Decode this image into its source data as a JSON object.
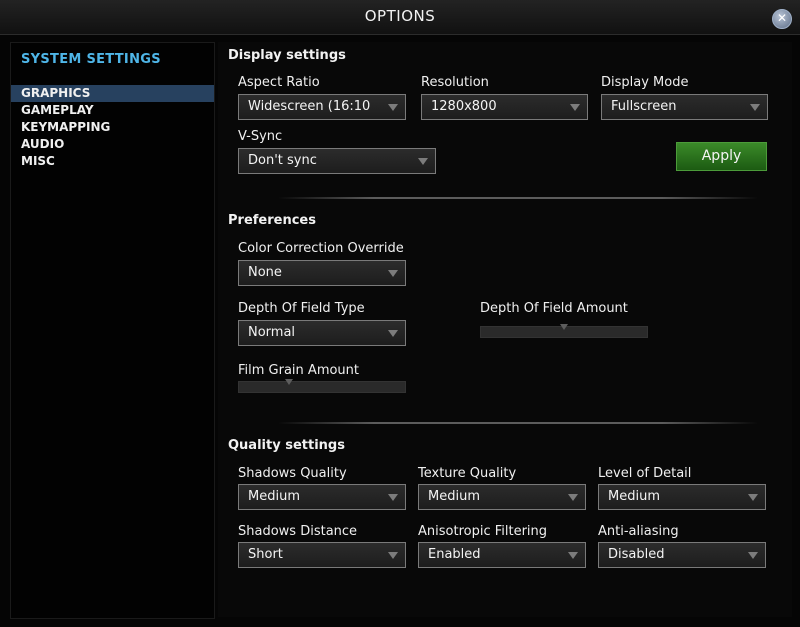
{
  "window": {
    "title": "OPTIONS"
  },
  "sidebar": {
    "heading": "SYSTEM SETTINGS",
    "items": [
      {
        "label": "GRAPHICS",
        "active": true
      },
      {
        "label": "GAMEPLAY",
        "active": false
      },
      {
        "label": "KEYMAPPING",
        "active": false
      },
      {
        "label": "AUDIO",
        "active": false
      },
      {
        "label": "MISC",
        "active": false
      }
    ]
  },
  "display": {
    "title": "Display settings",
    "aspect_ratio": {
      "label": "Aspect Ratio",
      "value": "Widescreen (16:10"
    },
    "resolution": {
      "label": "Resolution",
      "value": "1280x800"
    },
    "display_mode": {
      "label": "Display Mode",
      "value": "Fullscreen"
    },
    "vsync": {
      "label": "V-Sync",
      "value": "Don't sync"
    },
    "apply_label": "Apply"
  },
  "preferences": {
    "title": "Preferences",
    "color_correction": {
      "label": "Color Correction Override",
      "value": "None"
    },
    "dof_type": {
      "label": "Depth Of Field Type",
      "value": "Normal"
    },
    "dof_amount": {
      "label": "Depth Of Field Amount",
      "level": 0.5
    },
    "film_grain": {
      "label": "Film Grain Amount",
      "level": 0.3
    }
  },
  "quality": {
    "title": "Quality settings",
    "shadows_quality": {
      "label": "Shadows Quality",
      "value": "Medium"
    },
    "texture_quality": {
      "label": "Texture Quality",
      "value": "Medium"
    },
    "level_of_detail": {
      "label": "Level of Detail",
      "value": "Medium"
    },
    "shadows_distance": {
      "label": "Shadows Distance",
      "value": "Short"
    },
    "anisotropic": {
      "label": "Anisotropic Filtering",
      "value": "Enabled"
    },
    "antialiasing": {
      "label": "Anti-aliasing",
      "value": "Disabled"
    }
  },
  "colors": {
    "accent": "#4fb6e8",
    "active_nav": "#27415f",
    "apply_green": "#2f7a22",
    "background": "#050505"
  },
  "icons": {
    "close": "close-icon",
    "dropdown": "chevron-down-icon"
  }
}
